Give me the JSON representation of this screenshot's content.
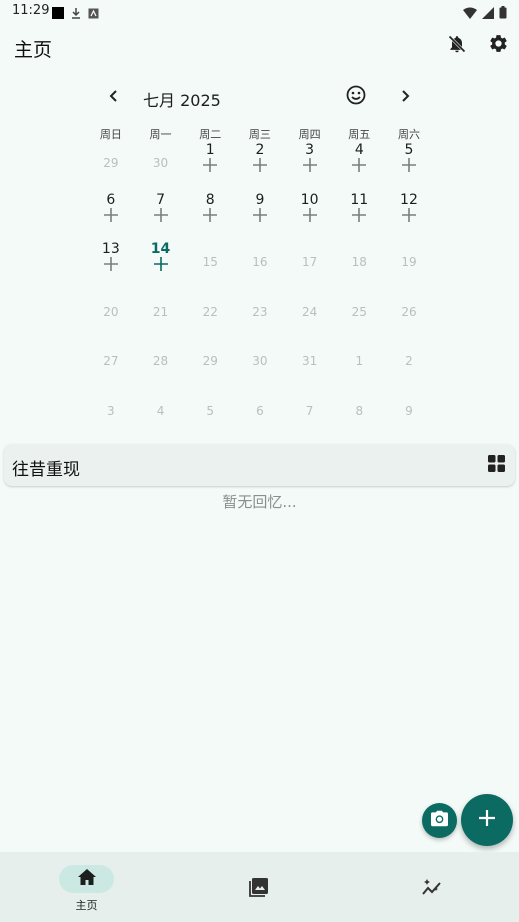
{
  "status_bar": {
    "time": "11:29"
  },
  "app_bar": {
    "title": "主页"
  },
  "calendar": {
    "month_label": "七月 2025",
    "weekdays": [
      "周日",
      "周一",
      "周二",
      "周三",
      "周四",
      "周五",
      "周六"
    ],
    "weeks": [
      [
        {
          "n": "29",
          "dim": true
        },
        {
          "n": "30",
          "dim": true
        },
        {
          "n": "1"
        },
        {
          "n": "2"
        },
        {
          "n": "3"
        },
        {
          "n": "4"
        },
        {
          "n": "5"
        }
      ],
      [
        {
          "n": "6"
        },
        {
          "n": "7"
        },
        {
          "n": "8"
        },
        {
          "n": "9"
        },
        {
          "n": "10"
        },
        {
          "n": "11"
        },
        {
          "n": "12"
        }
      ],
      [
        {
          "n": "13"
        },
        {
          "n": "14",
          "today": true
        },
        {
          "n": "15",
          "dim": true
        },
        {
          "n": "16",
          "dim": true
        },
        {
          "n": "17",
          "dim": true
        },
        {
          "n": "18",
          "dim": true
        },
        {
          "n": "19",
          "dim": true
        }
      ],
      [
        {
          "n": "20",
          "dim": true
        },
        {
          "n": "21",
          "dim": true
        },
        {
          "n": "22",
          "dim": true
        },
        {
          "n": "23",
          "dim": true
        },
        {
          "n": "24",
          "dim": true
        },
        {
          "n": "25",
          "dim": true
        },
        {
          "n": "26",
          "dim": true
        }
      ],
      [
        {
          "n": "27",
          "dim": true
        },
        {
          "n": "28",
          "dim": true
        },
        {
          "n": "29",
          "dim": true
        },
        {
          "n": "30",
          "dim": true
        },
        {
          "n": "31",
          "dim": true
        },
        {
          "n": "1",
          "dim": true
        },
        {
          "n": "2",
          "dim": true
        }
      ],
      [
        {
          "n": "3",
          "dim": true
        },
        {
          "n": "4",
          "dim": true
        },
        {
          "n": "5",
          "dim": true
        },
        {
          "n": "6",
          "dim": true
        },
        {
          "n": "7",
          "dim": true
        },
        {
          "n": "8",
          "dim": true
        },
        {
          "n": "9",
          "dim": true
        }
      ]
    ]
  },
  "memories": {
    "title": "往昔重现",
    "empty_text": "暂无回忆..."
  },
  "bottom_nav": {
    "home_label": "主页"
  },
  "colors": {
    "accent": "#0b6b62",
    "background": "#f3faf7",
    "nav_pill": "#cce8e3"
  }
}
